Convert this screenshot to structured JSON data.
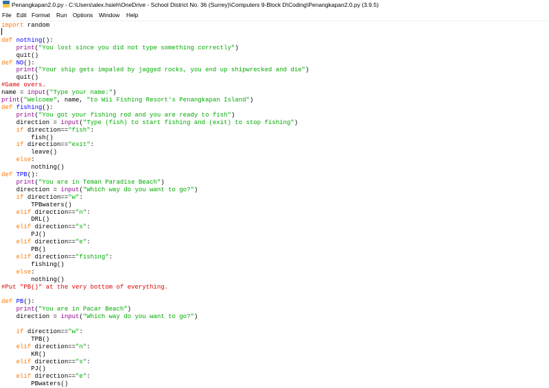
{
  "window": {
    "title": "Penangkapan2.0.py - C:\\Users\\alex.hsieh\\OneDrive - School District No. 36 (Surrey)\\Computers 9-Block D\\Coding\\Penangkapan2.0.py (3.9.5)",
    "icon": "python-file-icon"
  },
  "menu": [
    "File",
    "Edit",
    "Format",
    "Run",
    "Options",
    "Window",
    "Help"
  ],
  "colors": {
    "keyword": "#ff7700",
    "builtin": "#900090",
    "string": "#00aa00",
    "comment": "#dd0000",
    "defname": "#0000ff",
    "default": "#000000"
  },
  "code": [
    [
      [
        "keyword",
        "import"
      ],
      [
        "default",
        " random"
      ]
    ],
    [],
    [
      [
        "keyword",
        "def"
      ],
      [
        "default",
        " "
      ],
      [
        "defname",
        "nothing"
      ],
      [
        "default",
        "():"
      ]
    ],
    [
      [
        "default",
        "    "
      ],
      [
        "builtin",
        "print"
      ],
      [
        "default",
        "("
      ],
      [
        "string",
        "\"You lost since you did not type something correctly\""
      ],
      [
        "default",
        ")"
      ]
    ],
    [
      [
        "default",
        "    quit()"
      ]
    ],
    [
      [
        "keyword",
        "def"
      ],
      [
        "default",
        " "
      ],
      [
        "defname",
        "NO"
      ],
      [
        "default",
        "():"
      ]
    ],
    [
      [
        "default",
        "    "
      ],
      [
        "builtin",
        "print"
      ],
      [
        "default",
        "("
      ],
      [
        "string",
        "\"Your ship gets impaled by jagged rocks, you end up shipwrecked and die\""
      ],
      [
        "default",
        ")"
      ]
    ],
    [
      [
        "default",
        "    quit()"
      ]
    ],
    [
      [
        "comment",
        "#Game overs."
      ]
    ],
    [
      [
        "default",
        "name = "
      ],
      [
        "builtin",
        "input"
      ],
      [
        "default",
        "("
      ],
      [
        "string",
        "\"Type your name:\""
      ],
      [
        "default",
        ")"
      ]
    ],
    [
      [
        "builtin",
        "print"
      ],
      [
        "default",
        "("
      ],
      [
        "string",
        "\"Welcome\""
      ],
      [
        "default",
        ", name, "
      ],
      [
        "string",
        "\"to Wii Fishing Resort's Penangkapan Island\""
      ],
      [
        "default",
        ")"
      ]
    ],
    [
      [
        "keyword",
        "def"
      ],
      [
        "default",
        " "
      ],
      [
        "defname",
        "fishing"
      ],
      [
        "default",
        "():"
      ]
    ],
    [
      [
        "default",
        "    "
      ],
      [
        "builtin",
        "print"
      ],
      [
        "default",
        "("
      ],
      [
        "string",
        "\"You got your fishing rod and you are ready to fish\""
      ],
      [
        "default",
        ")"
      ]
    ],
    [
      [
        "default",
        "    direction = "
      ],
      [
        "builtin",
        "input"
      ],
      [
        "default",
        "("
      ],
      [
        "string",
        "\"Type (fish) to start fishing and (exit) to stop fishing\""
      ],
      [
        "default",
        ")"
      ]
    ],
    [
      [
        "default",
        "    "
      ],
      [
        "keyword",
        "if"
      ],
      [
        "default",
        " direction=="
      ],
      [
        "string",
        "\"fish\""
      ],
      [
        "default",
        ":"
      ]
    ],
    [
      [
        "default",
        "        fish()"
      ]
    ],
    [
      [
        "default",
        "    "
      ],
      [
        "keyword",
        "if"
      ],
      [
        "default",
        " direction=="
      ],
      [
        "string",
        "\"exit\""
      ],
      [
        "default",
        ":"
      ]
    ],
    [
      [
        "default",
        "        leave()"
      ]
    ],
    [
      [
        "default",
        "    "
      ],
      [
        "keyword",
        "else"
      ],
      [
        "default",
        ":"
      ]
    ],
    [
      [
        "default",
        "        nothing()"
      ]
    ],
    [
      [
        "keyword",
        "def"
      ],
      [
        "default",
        " "
      ],
      [
        "defname",
        "TPB"
      ],
      [
        "default",
        "():"
      ]
    ],
    [
      [
        "default",
        "    "
      ],
      [
        "builtin",
        "print"
      ],
      [
        "default",
        "("
      ],
      [
        "string",
        "\"You are in Teman Paradise Beach\""
      ],
      [
        "default",
        ")"
      ]
    ],
    [
      [
        "default",
        "    direction = "
      ],
      [
        "builtin",
        "input"
      ],
      [
        "default",
        "("
      ],
      [
        "string",
        "\"Which way do you want to go?\""
      ],
      [
        "default",
        ")"
      ]
    ],
    [
      [
        "default",
        "    "
      ],
      [
        "keyword",
        "if"
      ],
      [
        "default",
        " direction=="
      ],
      [
        "string",
        "\"w\""
      ],
      [
        "default",
        ":"
      ]
    ],
    [
      [
        "default",
        "        TPBwaters()"
      ]
    ],
    [
      [
        "default",
        "    "
      ],
      [
        "keyword",
        "elif"
      ],
      [
        "default",
        " direction=="
      ],
      [
        "string",
        "\"n\""
      ],
      [
        "default",
        ":"
      ]
    ],
    [
      [
        "default",
        "        DRL()"
      ]
    ],
    [
      [
        "default",
        "    "
      ],
      [
        "keyword",
        "elif"
      ],
      [
        "default",
        " direction=="
      ],
      [
        "string",
        "\"s\""
      ],
      [
        "default",
        ":"
      ]
    ],
    [
      [
        "default",
        "        PJ()"
      ]
    ],
    [
      [
        "default",
        "    "
      ],
      [
        "keyword",
        "elif"
      ],
      [
        "default",
        " direction=="
      ],
      [
        "string",
        "\"e\""
      ],
      [
        "default",
        ":"
      ]
    ],
    [
      [
        "default",
        "        PB()"
      ]
    ],
    [
      [
        "default",
        "    "
      ],
      [
        "keyword",
        "elif"
      ],
      [
        "default",
        " direction=="
      ],
      [
        "string",
        "\"fishing\""
      ],
      [
        "default",
        ":"
      ]
    ],
    [
      [
        "default",
        "        fishing()"
      ]
    ],
    [
      [
        "default",
        "    "
      ],
      [
        "keyword",
        "else"
      ],
      [
        "default",
        ":"
      ]
    ],
    [
      [
        "default",
        "        nothing()"
      ]
    ],
    [
      [
        "comment",
        "#Put \"PB()\" at the very bottom of everything."
      ]
    ],
    [],
    [
      [
        "keyword",
        "def"
      ],
      [
        "default",
        " "
      ],
      [
        "defname",
        "PB"
      ],
      [
        "default",
        "():"
      ]
    ],
    [
      [
        "default",
        "    "
      ],
      [
        "builtin",
        "print"
      ],
      [
        "default",
        "("
      ],
      [
        "string",
        "\"You are in Pacar Beach\""
      ],
      [
        "default",
        ")"
      ]
    ],
    [
      [
        "default",
        "    direction = "
      ],
      [
        "builtin",
        "input"
      ],
      [
        "default",
        "("
      ],
      [
        "string",
        "\"Which way do you want to go?\""
      ],
      [
        "default",
        ")"
      ]
    ],
    [],
    [
      [
        "default",
        "    "
      ],
      [
        "keyword",
        "if"
      ],
      [
        "default",
        " direction=="
      ],
      [
        "string",
        "\"w\""
      ],
      [
        "default",
        ":"
      ]
    ],
    [
      [
        "default",
        "        TPB()"
      ]
    ],
    [
      [
        "default",
        "    "
      ],
      [
        "keyword",
        "elif"
      ],
      [
        "default",
        " direction=="
      ],
      [
        "string",
        "\"n\""
      ],
      [
        "default",
        ":"
      ]
    ],
    [
      [
        "default",
        "        KR()"
      ]
    ],
    [
      [
        "default",
        "    "
      ],
      [
        "keyword",
        "elif"
      ],
      [
        "default",
        " direction=="
      ],
      [
        "string",
        "\"s\""
      ],
      [
        "default",
        ":"
      ]
    ],
    [
      [
        "default",
        "        PJ()"
      ]
    ],
    [
      [
        "default",
        "    "
      ],
      [
        "keyword",
        "elif"
      ],
      [
        "default",
        " direction=="
      ],
      [
        "string",
        "\"e\""
      ],
      [
        "default",
        ":"
      ]
    ],
    [
      [
        "default",
        "        PBwaters()"
      ]
    ]
  ]
}
